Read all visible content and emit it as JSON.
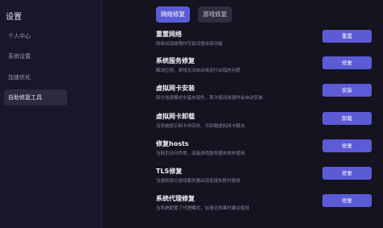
{
  "sidebar": {
    "title": "设置",
    "items": [
      {
        "label": "个人中心"
      },
      {
        "label": "系统设置"
      },
      {
        "label": "加速优化"
      },
      {
        "label": "自助修复工具"
      }
    ]
  },
  "tabs": [
    {
      "label": "网络修复"
    },
    {
      "label": "游戏修复"
    }
  ],
  "repairs": [
    {
      "title": "重置网络",
      "desc": "网络出现故障时可尝试使用该功能",
      "button": "重置"
    },
    {
      "title": "系统服务修复",
      "desc": "解决应用、游戏无法启动或运行出错的问题",
      "button": "修复"
    },
    {
      "title": "虚拟网卡安装",
      "desc": "部分加速模式中基本组件，首次使用加速时会自动安装",
      "button": "安装"
    },
    {
      "title": "虚拟网卡卸载",
      "desc": "当系统提示网卡冲突时，可卸载虚拟网卡解决",
      "button": "卸载"
    },
    {
      "title": "修复hosts",
      "desc": "当网页访问异常、连接游戏服务器失败时使用",
      "button": "修复"
    },
    {
      "title": "TLS修复",
      "desc": "当遇到部分游戏服务器出现连接失败时使用",
      "button": "修复"
    },
    {
      "title": "系统代理修复",
      "desc": "当系统配置了代理模式，加速无效果时建议使用",
      "button": "修复"
    }
  ],
  "colors": {
    "accent": "#5b5bd6",
    "background": "#14131f",
    "sidebar": "#17162a"
  }
}
